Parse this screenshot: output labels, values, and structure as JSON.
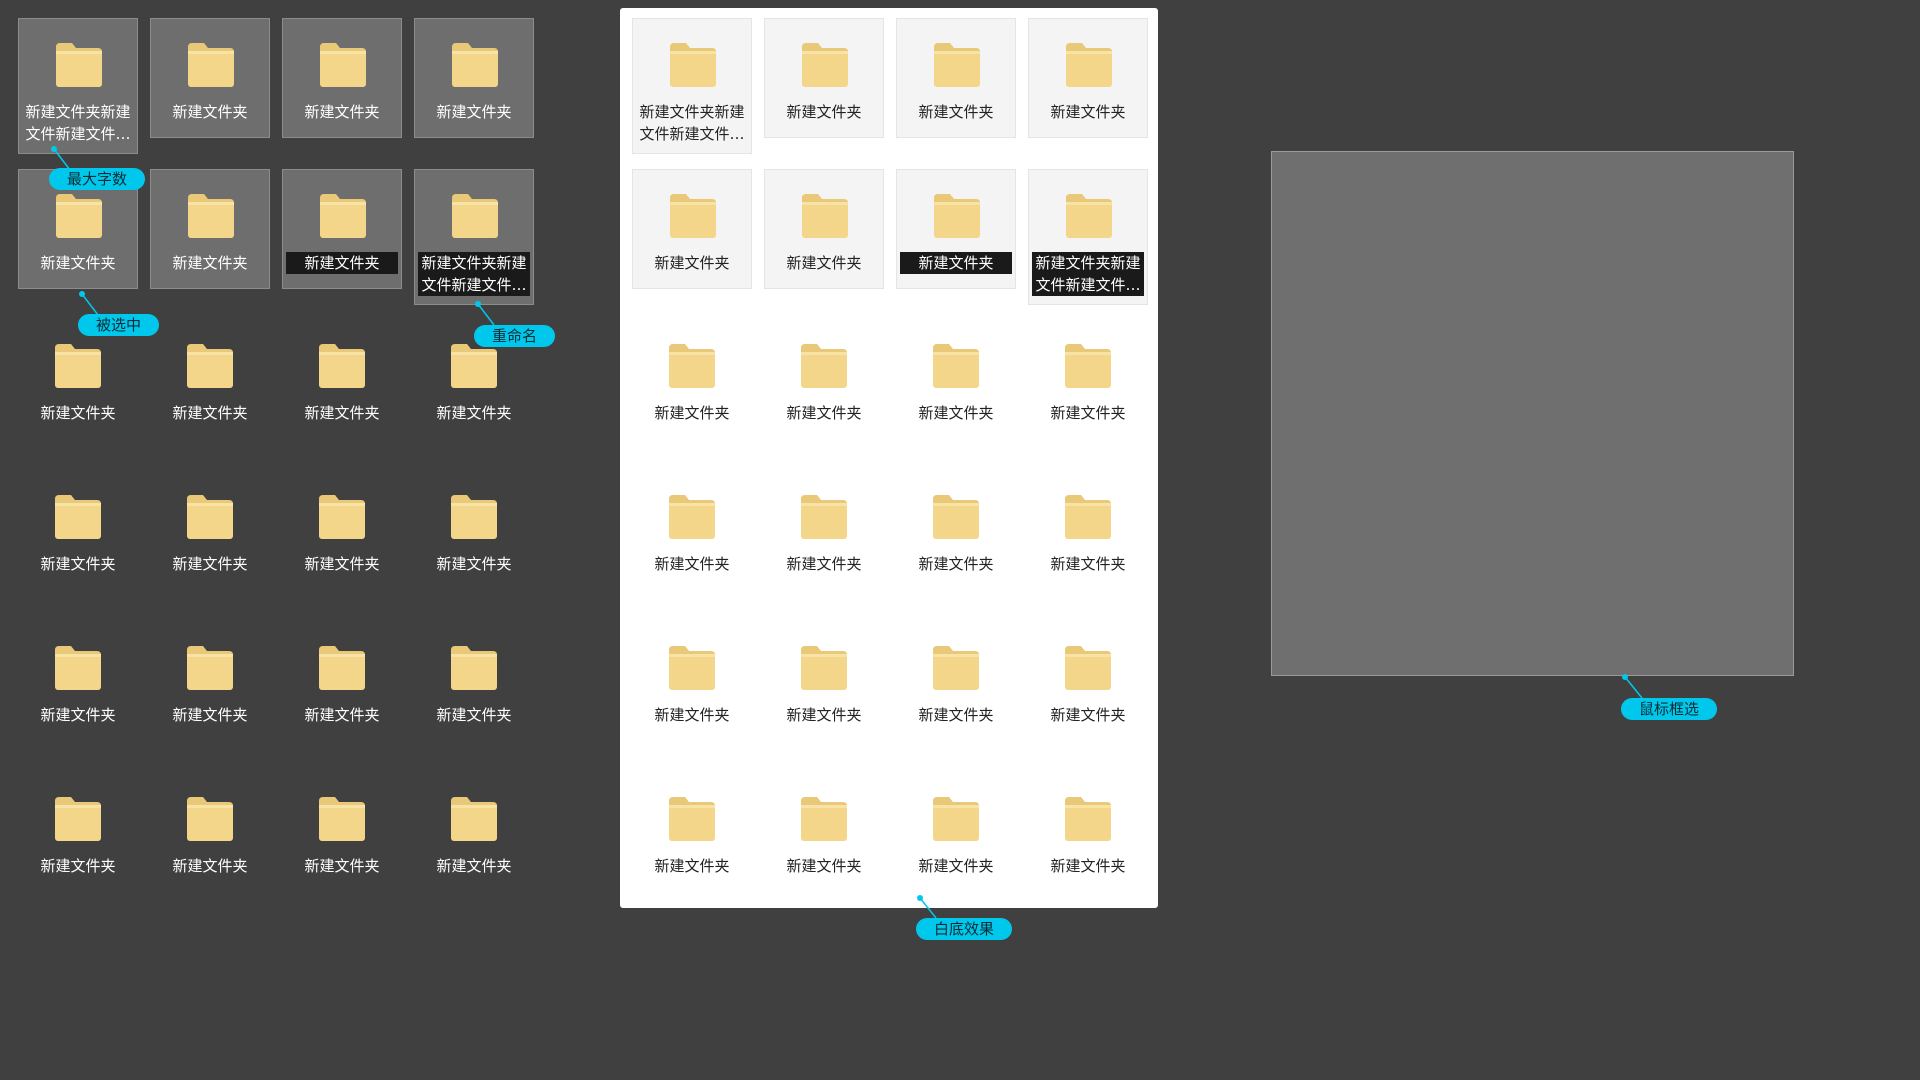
{
  "dark_grid": {
    "rows": [
      [
        {
          "label": "新建文件夹新建文件新建文件…",
          "style": "long"
        },
        {
          "label": "新建文件夹",
          "style": "boxed"
        },
        {
          "label": "新建文件夹",
          "style": "boxed"
        },
        {
          "label": "新建文件夹",
          "style": "boxed"
        }
      ],
      [
        {
          "label": "新建文件夹",
          "style": "boxed"
        },
        {
          "label": "新建文件夹",
          "style": "boxed"
        },
        {
          "label": "新建文件夹",
          "style": "rename"
        },
        {
          "label": "新建文件夹新建文件新建文件…",
          "style": "long-rename"
        }
      ],
      [
        {
          "label": "新建文件夹",
          "style": "plain"
        },
        {
          "label": "新建文件夹",
          "style": "plain"
        },
        {
          "label": "新建文件夹",
          "style": "plain"
        },
        {
          "label": "新建文件夹",
          "style": "plain"
        }
      ],
      [
        {
          "label": "新建文件夹",
          "style": "plain"
        },
        {
          "label": "新建文件夹",
          "style": "plain"
        },
        {
          "label": "新建文件夹",
          "style": "plain"
        },
        {
          "label": "新建文件夹",
          "style": "plain"
        }
      ],
      [
        {
          "label": "新建文件夹",
          "style": "plain"
        },
        {
          "label": "新建文件夹",
          "style": "plain"
        },
        {
          "label": "新建文件夹",
          "style": "plain"
        },
        {
          "label": "新建文件夹",
          "style": "plain"
        }
      ],
      [
        {
          "label": "新建文件夹",
          "style": "plain"
        },
        {
          "label": "新建文件夹",
          "style": "plain"
        },
        {
          "label": "新建文件夹",
          "style": "plain"
        },
        {
          "label": "新建文件夹",
          "style": "plain"
        }
      ]
    ]
  },
  "white_grid": {
    "rows": [
      [
        {
          "label": "新建文件夹新建文件新建文件…",
          "style": "long"
        },
        {
          "label": "新建文件夹",
          "style": "boxed"
        },
        {
          "label": "新建文件夹",
          "style": "boxed"
        },
        {
          "label": "新建文件夹",
          "style": "boxed"
        }
      ],
      [
        {
          "label": "新建文件夹",
          "style": "boxed"
        },
        {
          "label": "新建文件夹",
          "style": "boxed"
        },
        {
          "label": "新建文件夹",
          "style": "rename"
        },
        {
          "label": "新建文件夹新建文件新建文件…",
          "style": "long-rename"
        }
      ],
      [
        {
          "label": "新建文件夹",
          "style": "plain"
        },
        {
          "label": "新建文件夹",
          "style": "plain"
        },
        {
          "label": "新建文件夹",
          "style": "plain"
        },
        {
          "label": "新建文件夹",
          "style": "plain"
        }
      ],
      [
        {
          "label": "新建文件夹",
          "style": "plain"
        },
        {
          "label": "新建文件夹",
          "style": "plain"
        },
        {
          "label": "新建文件夹",
          "style": "plain"
        },
        {
          "label": "新建文件夹",
          "style": "plain"
        }
      ],
      [
        {
          "label": "新建文件夹",
          "style": "plain"
        },
        {
          "label": "新建文件夹",
          "style": "plain"
        },
        {
          "label": "新建文件夹",
          "style": "plain"
        },
        {
          "label": "新建文件夹",
          "style": "plain"
        }
      ],
      [
        {
          "label": "新建文件夹",
          "style": "plain"
        },
        {
          "label": "新建文件夹",
          "style": "plain"
        },
        {
          "label": "新建文件夹",
          "style": "plain"
        },
        {
          "label": "新建文件夹",
          "style": "plain"
        }
      ]
    ]
  },
  "callouts": {
    "max_chars": "最大字数",
    "selected": "被选中",
    "rename": "重命名",
    "white_bg": "白底效果",
    "marquee": "鼠标框选"
  },
  "colors": {
    "background": "#404040",
    "accent": "#00c8ec",
    "folder_body": "#f3d68a",
    "folder_tab": "#e9c877"
  },
  "icons": {
    "folder": "folder-icon"
  }
}
